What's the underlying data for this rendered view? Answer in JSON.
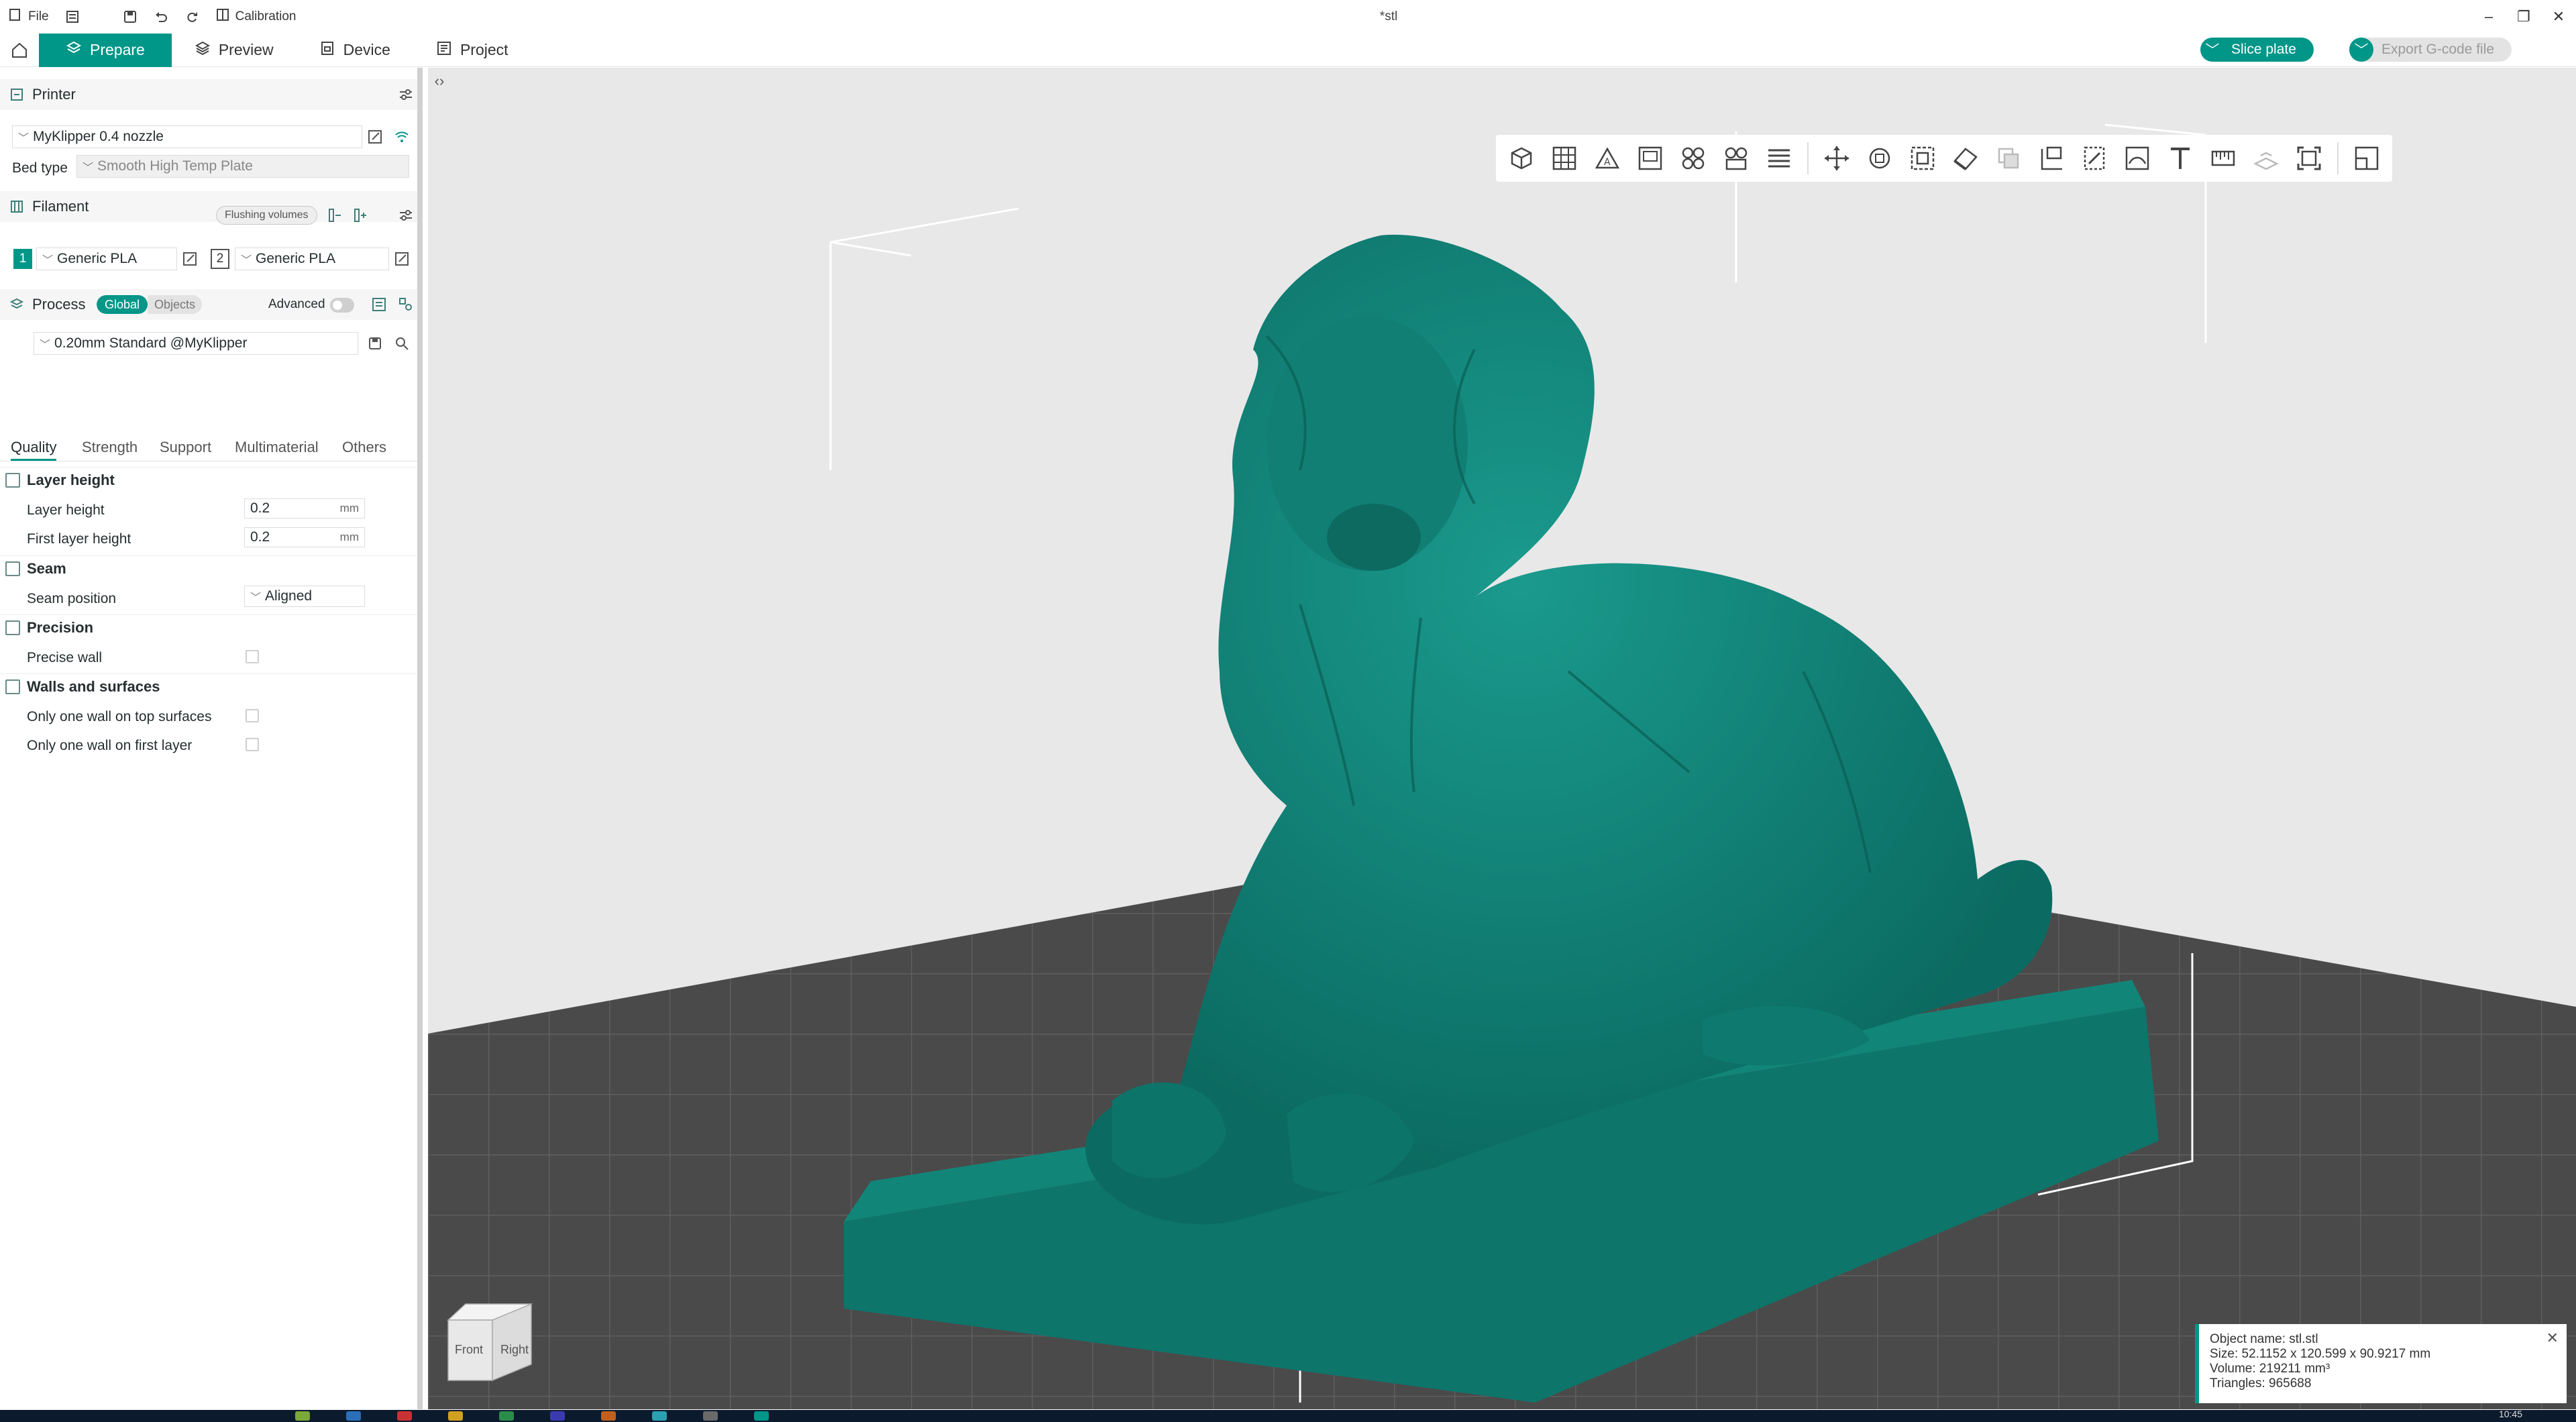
{
  "app": {
    "file_menu": "File",
    "calibration": "Calibration",
    "doc_title": "*stl"
  },
  "tabs": [
    {
      "label": "Prepare",
      "active": true
    },
    {
      "label": "Preview"
    },
    {
      "label": "Device"
    },
    {
      "label": "Project"
    }
  ],
  "actions": {
    "slice": "Slice plate",
    "export": "Export G-code file"
  },
  "printer": {
    "header": "Printer",
    "name": "MyKlipper 0.4 nozzle",
    "bed_type_label": "Bed type",
    "bed_type": "Smooth High Temp Plate"
  },
  "filament": {
    "header": "Filament",
    "flushing": "Flushing volumes",
    "slots": [
      {
        "index": "1",
        "name": "Generic PLA"
      },
      {
        "index": "2",
        "name": "Generic PLA"
      }
    ]
  },
  "process": {
    "header": "Process",
    "global": "Global",
    "objects": "Objects",
    "advanced": "Advanced",
    "preset": "0.20mm Standard @MyKlipper",
    "subtabs": [
      "Quality",
      "Strength",
      "Support",
      "Multimaterial",
      "Others"
    ]
  },
  "quality": {
    "layer_height_group": "Layer height",
    "layer_height_label": "Layer height",
    "layer_height": "0.2",
    "first_layer_label": "First layer height",
    "first_layer": "0.2",
    "unit": "mm",
    "seam_group": "Seam",
    "seam_position_label": "Seam position",
    "seam_position": "Aligned",
    "precision_group": "Precision",
    "precise_wall_label": "Precise wall",
    "precise_wall": false,
    "walls_group": "Walls and surfaces",
    "one_wall_top_label": "Only one wall on top surfaces",
    "one_wall_top": false,
    "one_wall_first_label": "Only one wall on first layer",
    "one_wall_first": false
  },
  "navcube": {
    "front": "Front",
    "right": "Right"
  },
  "object_info": {
    "name": "Object name: stl.stl",
    "size": "Size: 52.1152 x 120.599 x 90.9217 mm",
    "volume": "Volume: 219211 mm³",
    "triangles": "Triangles: 965688"
  },
  "taskbar": {
    "clock": "10:45"
  },
  "colors": {
    "accent": "#009688",
    "model": "#0f7f74",
    "bed": "#444444"
  }
}
